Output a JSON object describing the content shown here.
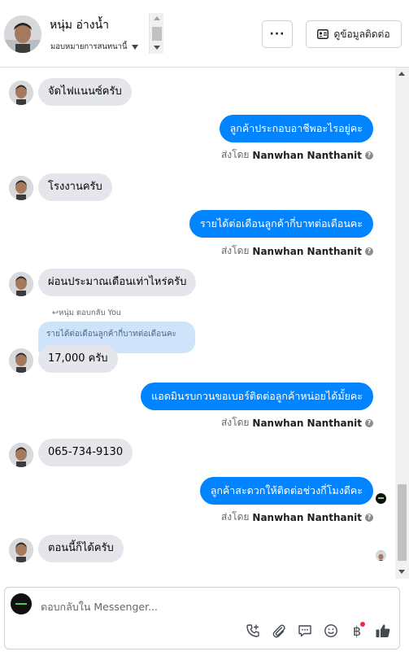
{
  "header": {
    "contact_name": "หนุ่ม อ่างน้ำ",
    "assign_label": "มอบหมายการสนทนานี้",
    "more_label": "···",
    "contact_info_label": "ดูข้อมูลติดต่อ"
  },
  "messages": [
    {
      "direction": "in",
      "text": "จัดไฟแนนซ์ครับ"
    },
    {
      "direction": "out",
      "text": "ลูกค้าประกอบอาชีพอะไรอยู่คะ",
      "sent_by_prefix": "ส่งโดย",
      "sent_by_name": "Nanwhan Nanthanit"
    },
    {
      "direction": "in",
      "text": "โรงงานครับ"
    },
    {
      "direction": "out",
      "text": "รายได้ต่อเดือนลูกค้ากี่บาทต่อเดือนคะ",
      "sent_by_prefix": "ส่งโดย",
      "sent_by_name": "Nanwhan Nanthanit"
    },
    {
      "direction": "in",
      "text": "ผ่อนประมาณเดือนเท่าไหร่ครับ"
    },
    {
      "direction": "in",
      "text": "17,000 ครับ",
      "reply_note": "หนุ่ม ตอบกลับ You",
      "quoted_text": "รายได้ต่อเดือนลูกค้ากี่บาทต่อเดือนคะ"
    },
    {
      "direction": "out",
      "text": "แอดมินรบกวนขอเบอร์ติดต่อลูกค้าหน่อยได้มั้ยคะ",
      "sent_by_prefix": "ส่งโดย",
      "sent_by_name": "Nanwhan Nanthanit"
    },
    {
      "direction": "in",
      "text": "065-734-9130"
    },
    {
      "direction": "out",
      "text": "ลูกค้าสะดวกให้ติดต่อช่วงกี่โมงดีคะ",
      "sent_by_prefix": "ส่งโดย",
      "sent_by_name": "Nanwhan Nanthanit"
    },
    {
      "direction": "in",
      "text": "ตอนนี้ก็ได้ครับ"
    }
  ],
  "composer": {
    "placeholder": "ตอบกลับใน Messenger...",
    "tools": [
      "add-call-icon",
      "paperclip-icon",
      "chat-bubble-icon",
      "emoji-icon",
      "baht-icon",
      "thumbs-up-icon"
    ],
    "baht_symbol": "฿"
  },
  "colors": {
    "outgoing_bubble": "#0084ff",
    "incoming_bubble": "#e4e6eb",
    "quoted_bubble": "#cfe3fb",
    "like_icon": "#444950",
    "notification_dot": "#f02849"
  }
}
